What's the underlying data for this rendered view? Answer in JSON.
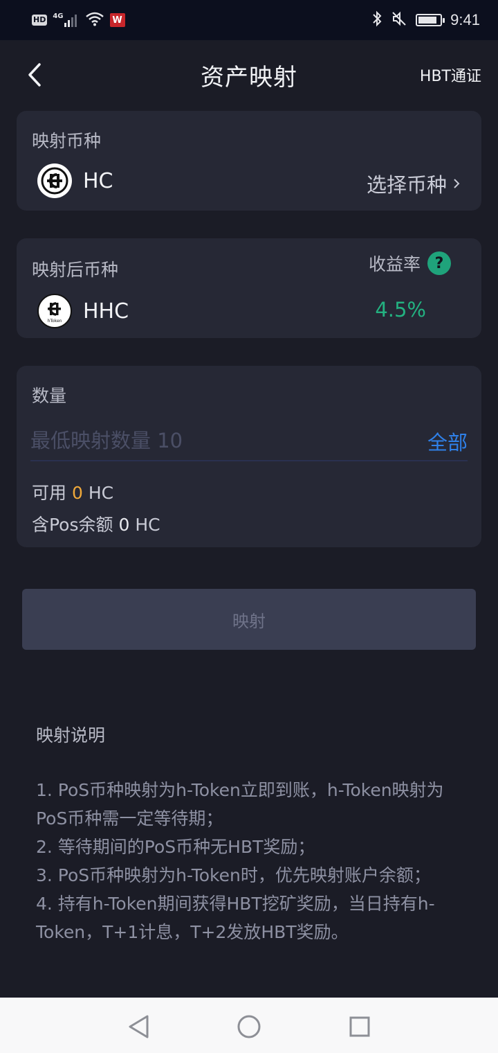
{
  "status_bar": {
    "hd": "HD",
    "network": "4G",
    "app_badge": "W",
    "time": "9:41",
    "battery_level": 0.85
  },
  "header": {
    "title": "资产映射",
    "right_link": "HBT通证"
  },
  "source_coin": {
    "label": "映射币种",
    "name": "HC",
    "select_label": "选择币种"
  },
  "target_coin": {
    "label": "映射后币种",
    "name": "HHC",
    "logo_caption": "hToken",
    "rate_label": "收益率",
    "rate_value": "4.5%"
  },
  "amount": {
    "label": "数量",
    "placeholder": "最低映射数量 10",
    "all_label": "全部",
    "available_prefix": "可用",
    "available_value": "0",
    "available_unit": "HC",
    "pos_prefix": "含Pos余额",
    "pos_value": "0",
    "pos_unit": "HC"
  },
  "map_button": "映射",
  "notes": {
    "title": "映射说明",
    "items": [
      "1. PoS币种映射为h-Token立即到账，h-Token映射为PoS币种需一定等待期；",
      "2. 等待期间的PoS币种无HBT奖励；",
      "3. PoS币种映射为h-Token时，优先映射账户余额；",
      "4. 持有h-Token期间获得HBT挖矿奖励，当日持有h-Token，T+1计息，T+2发放HBT奖励。"
    ]
  },
  "colors": {
    "background": "#1b1c26",
    "card": "#262835",
    "accent_blue": "#2f80e8",
    "rate_green": "#23b281",
    "available_orange": "#f0a93a"
  }
}
